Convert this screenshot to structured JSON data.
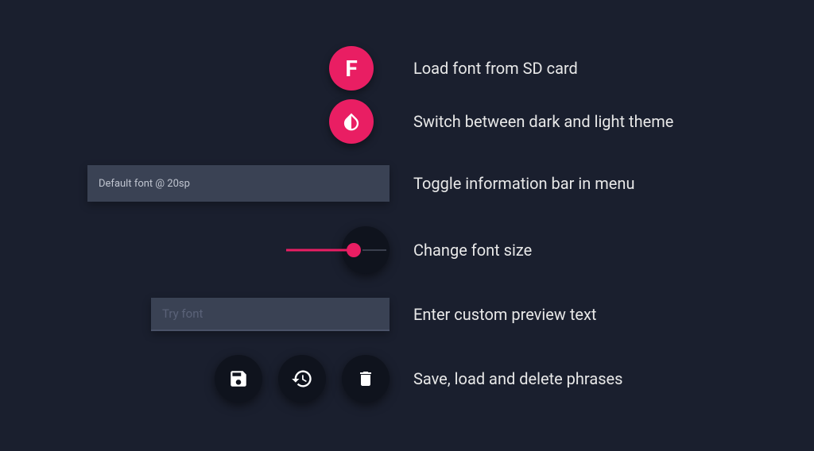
{
  "accent_color": "#e91e63",
  "bg_color": "#1a1f2e",
  "rows": {
    "load_font": {
      "icon_letter": "F",
      "label": "Load font from SD card"
    },
    "theme": {
      "label": "Switch between dark and light theme"
    },
    "info_bar": {
      "value": "Default font @ 20sp",
      "label": "Toggle information bar in menu"
    },
    "font_size": {
      "label": "Change font size"
    },
    "preview": {
      "placeholder": "Try font",
      "label": "Enter custom preview text"
    },
    "phrases": {
      "label": "Save, load and delete phrases"
    }
  }
}
